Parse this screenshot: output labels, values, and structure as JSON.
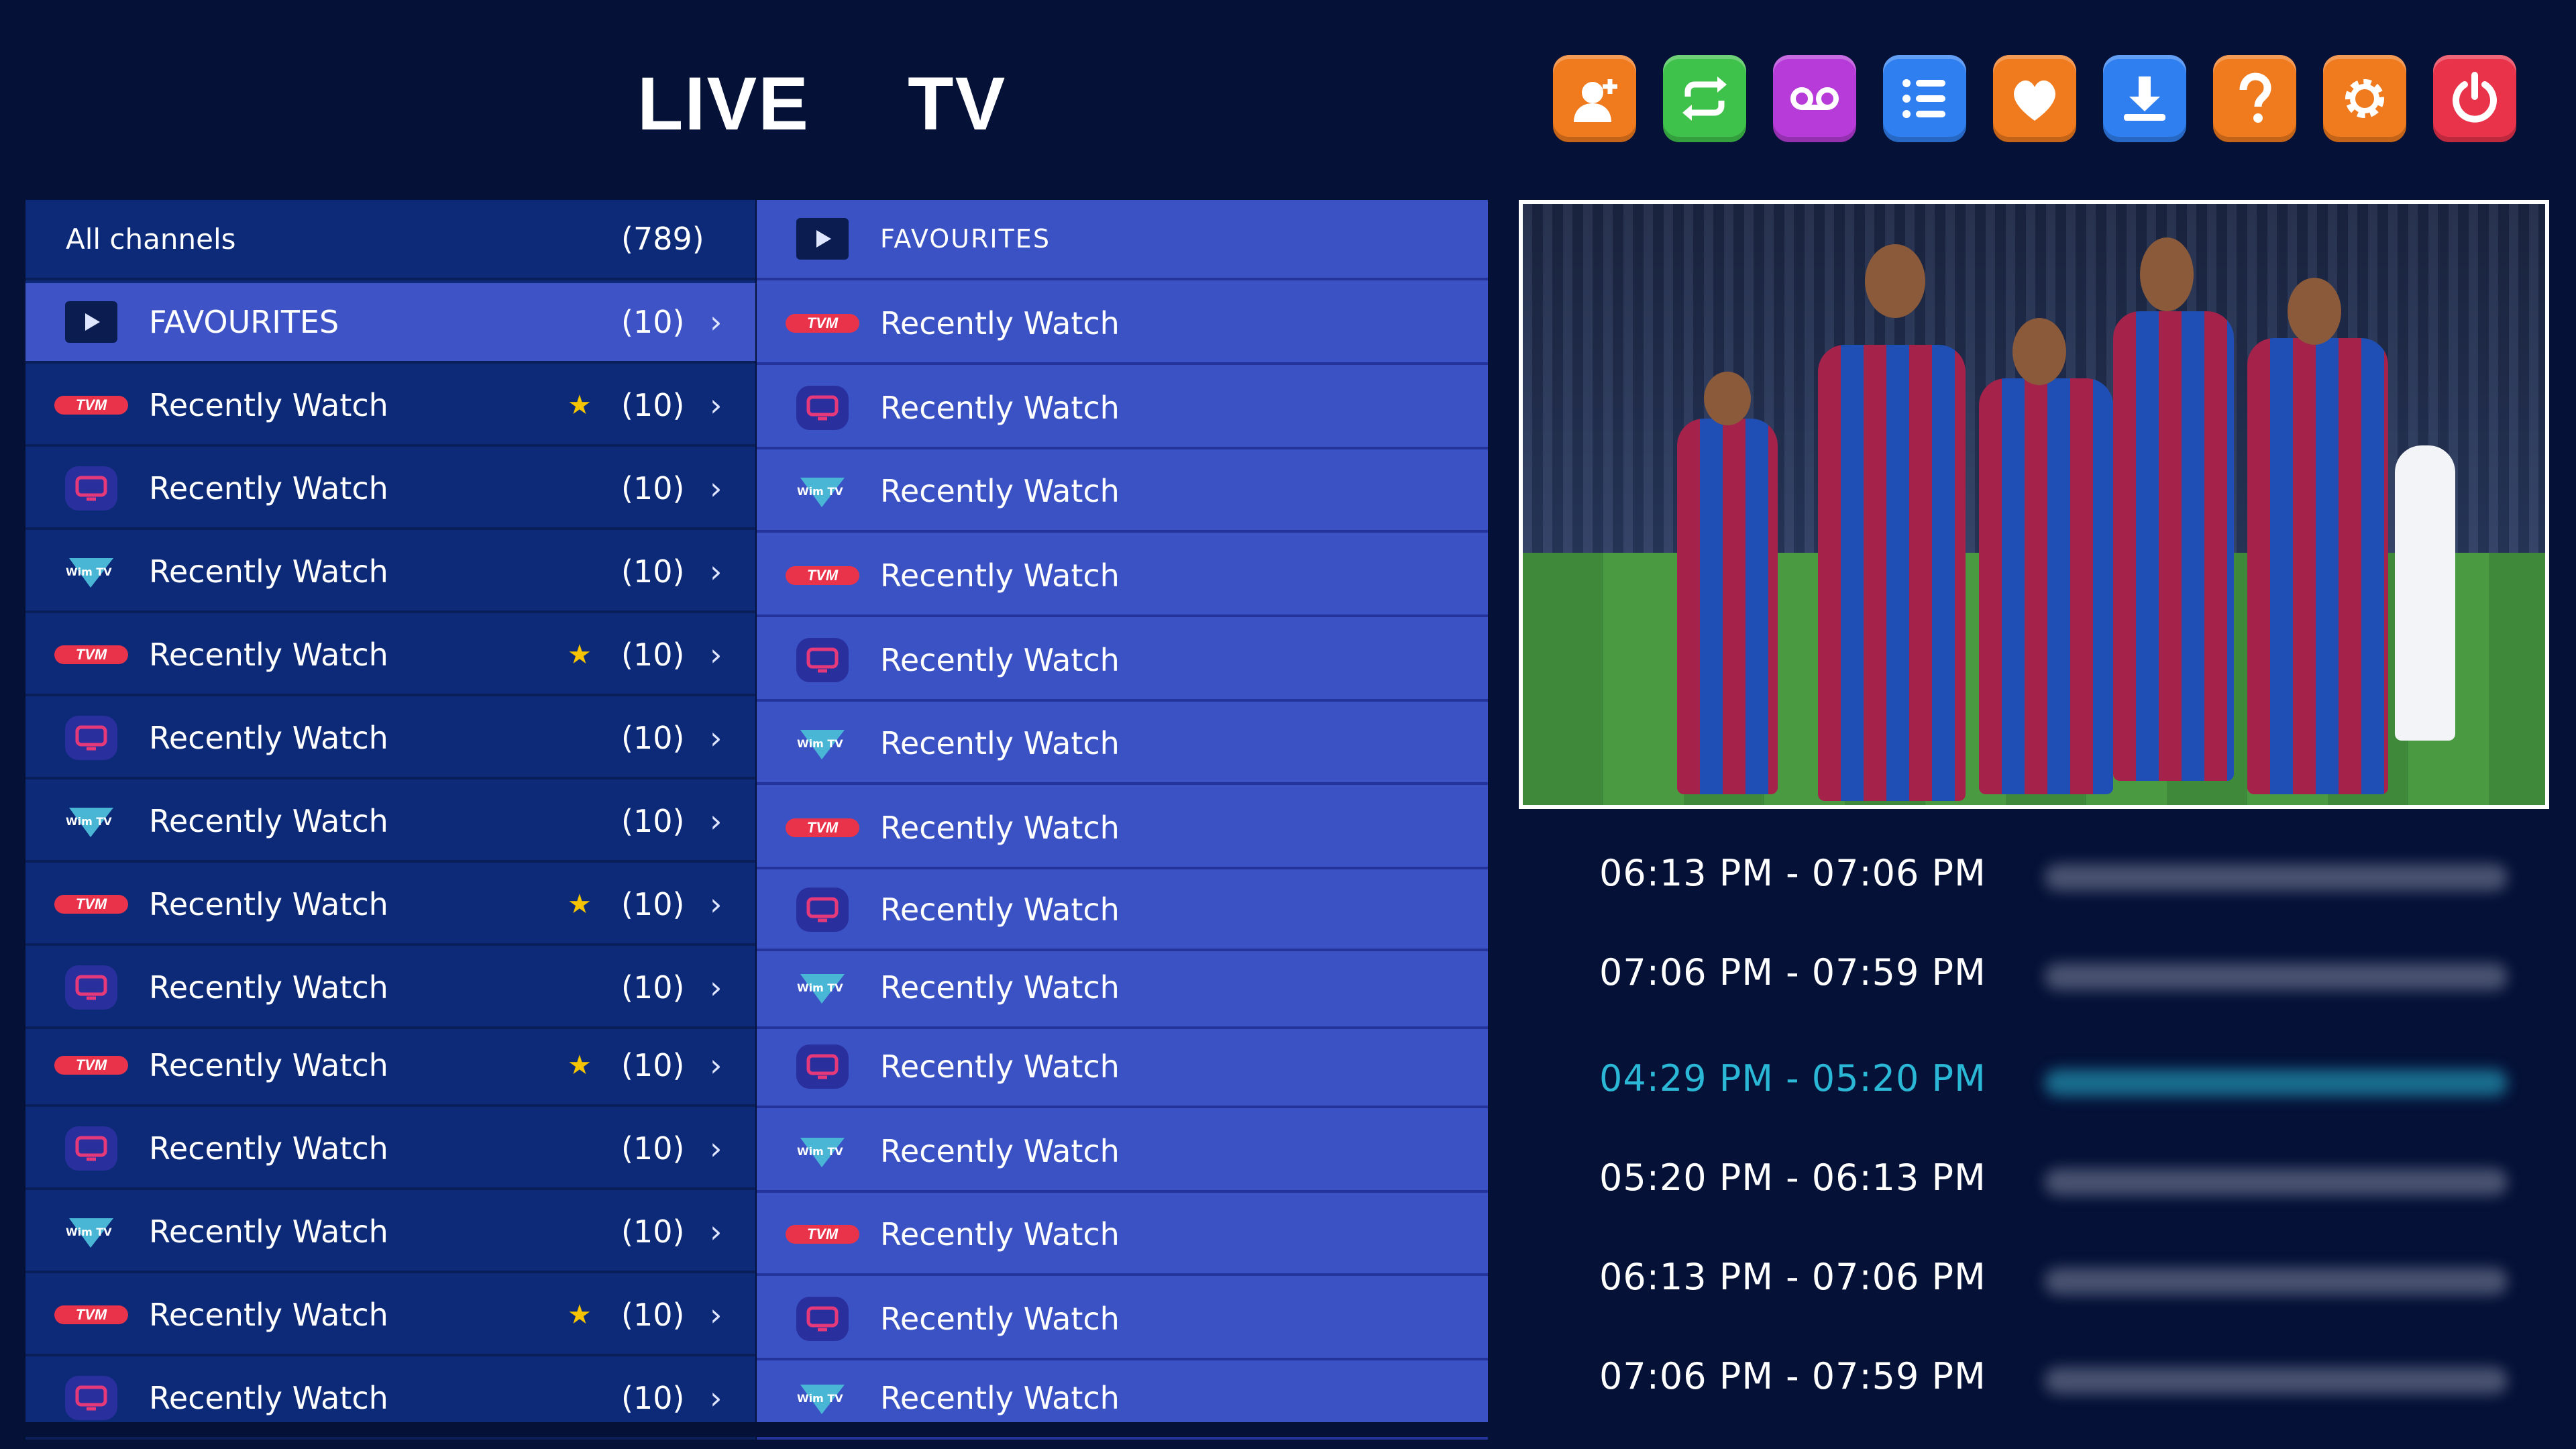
{
  "header": {
    "title": "LIVE  TV"
  },
  "toolbar": [
    {
      "name": "add-user-icon",
      "color": "#f07a1e"
    },
    {
      "name": "repeat-icon",
      "color": "#3fc24b"
    },
    {
      "name": "voicemail-icon",
      "color": "#b63bd8"
    },
    {
      "name": "list-icon",
      "color": "#2f7ff0"
    },
    {
      "name": "heart-icon",
      "color": "#f07a1e"
    },
    {
      "name": "download-icon",
      "color": "#2f7ff0"
    },
    {
      "name": "help-icon",
      "color": "#f07a1e"
    },
    {
      "name": "gear-icon",
      "color": "#f07a1e"
    },
    {
      "name": "power-icon",
      "color": "#e8334b"
    }
  ],
  "categories": {
    "header": {
      "label": "All channels",
      "count": "(789)"
    },
    "items": [
      {
        "logo": "play",
        "label": "FAVOURITES",
        "count": "(10)",
        "star": false,
        "selected": true
      },
      {
        "logo": "tvm",
        "label": "Recently Watch",
        "count": "(10)",
        "star": true
      },
      {
        "logo": "tv",
        "label": "Recently Watch",
        "count": "(10)",
        "star": false
      },
      {
        "logo": "wim",
        "label": "Recently Watch",
        "count": "(10)",
        "star": false
      },
      {
        "logo": "tvm",
        "label": "Recently Watch",
        "count": "(10)",
        "star": true
      },
      {
        "logo": "tv",
        "label": "Recently Watch",
        "count": "(10)",
        "star": false
      },
      {
        "logo": "wim",
        "label": "Recently Watch",
        "count": "(10)",
        "star": false
      },
      {
        "logo": "tvm",
        "label": "Recently Watch",
        "count": "(10)",
        "star": true
      },
      {
        "logo": "tv",
        "label": "Recently Watch",
        "count": "(10)",
        "star": false
      },
      {
        "logo": "tvm",
        "label": "Recently Watch",
        "count": "(10)",
        "star": true
      },
      {
        "logo": "tv",
        "label": "Recently Watch",
        "count": "(10)",
        "star": false
      },
      {
        "logo": "wim",
        "label": "Recently Watch",
        "count": "(10)",
        "star": false
      },
      {
        "logo": "tvm",
        "label": "Recently Watch",
        "count": "(10)",
        "star": true
      },
      {
        "logo": "tv",
        "label": "Recently Watch",
        "count": "(10)",
        "star": false
      }
    ],
    "arrow": "›",
    "star_glyph": "★"
  },
  "channels": {
    "header": {
      "logo": "play",
      "label": "FAVOURITES"
    },
    "items": [
      {
        "logo": "tvm",
        "label": "Recently Watch"
      },
      {
        "logo": "tv",
        "label": "Recently Watch"
      },
      {
        "logo": "wim",
        "label": "Recently Watch"
      },
      {
        "logo": "tvm",
        "label": "Recently Watch"
      },
      {
        "logo": "tv",
        "label": "Recently Watch"
      },
      {
        "logo": "wim",
        "label": "Recently Watch"
      },
      {
        "logo": "tvm",
        "label": "Recently Watch"
      },
      {
        "logo": "tv",
        "label": "Recently Watch"
      },
      {
        "logo": "wim",
        "label": "Recently Watch"
      },
      {
        "logo": "tv",
        "label": "Recently Watch"
      },
      {
        "logo": "wim",
        "label": "Recently Watch"
      },
      {
        "logo": "tvm",
        "label": "Recently Watch"
      },
      {
        "logo": "tv",
        "label": "Recently Watch"
      },
      {
        "logo": "wim",
        "label": "Recently Watch"
      }
    ]
  },
  "logos": {
    "tvm": "TVM",
    "wim": "Wim TV"
  },
  "epg": [
    {
      "time": "06:13 PM - 07:06 PM",
      "active": false
    },
    {
      "time": "07:06 PM - 07:59 PM",
      "active": false
    },
    {
      "time": "04:29 PM - 05:20 PM",
      "active": true
    },
    {
      "time": "05:20 PM - 06:13 PM",
      "active": false
    },
    {
      "time": "06:13 PM - 07:06 PM",
      "active": false
    },
    {
      "time": "07:06 PM - 07:59 PM",
      "active": false
    }
  ],
  "colors": {
    "background": "#051137",
    "category_bg": "#0d2a78",
    "selected_bg": "#3e54c6",
    "channel_bg": "#3a52c4",
    "epg_active": "#2ab8d6"
  }
}
